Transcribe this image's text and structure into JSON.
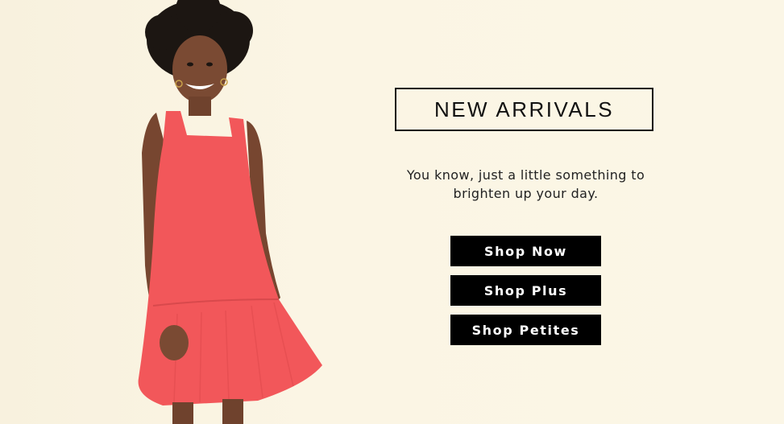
{
  "banner": {
    "headline": "NEW ARRIVALS",
    "tagline_line1": "You know, just a little something to",
    "tagline_line2": "brighten up your day.",
    "buttons": [
      {
        "label": "Shop Now"
      },
      {
        "label": "Shop Plus"
      },
      {
        "label": "Shop Petites"
      }
    ]
  },
  "colors": {
    "background": "#fbf5e4",
    "button": "#000000",
    "button_text": "#ffffff",
    "dress": "#f2575a",
    "headline_border": "#111111"
  },
  "image": {
    "subject": "model-in-coral-dress"
  }
}
